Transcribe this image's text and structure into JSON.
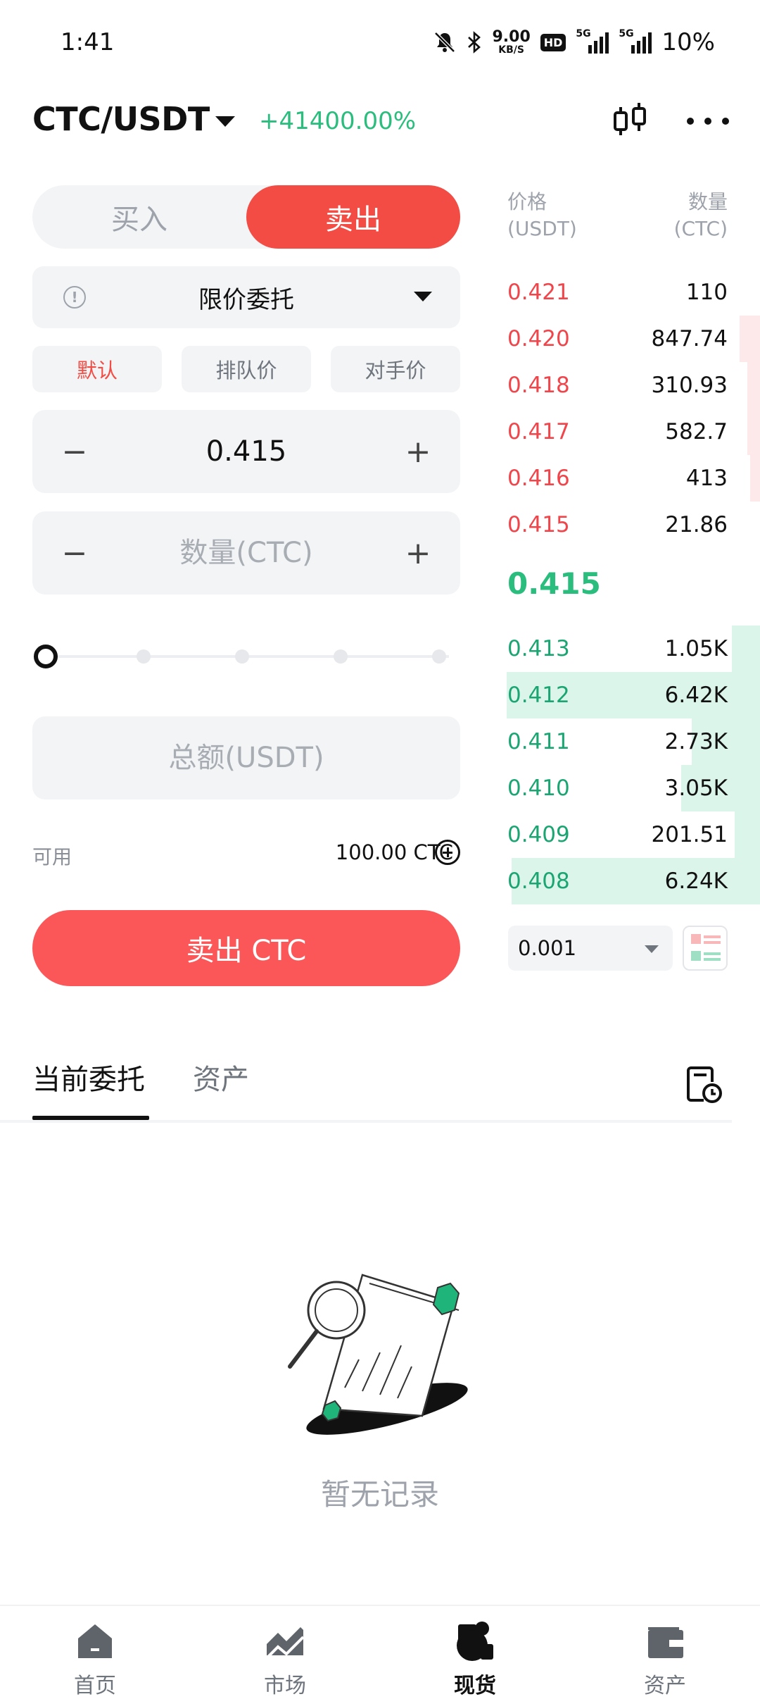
{
  "status_bar": {
    "time": "1:41",
    "net_speed_value": "9.00",
    "net_speed_unit": "KB/S",
    "hd_label": "HD",
    "sim1_label": "5G",
    "sim2_label": "5G",
    "battery": "10%"
  },
  "header": {
    "pair": "CTC/USDT",
    "change": "+41400.00%"
  },
  "trade_form": {
    "buy_label": "买入",
    "sell_label": "卖出",
    "order_type": "限价委托",
    "price_modes": [
      "默认",
      "排队价",
      "对手价"
    ],
    "price_value": "0.415",
    "quantity_placeholder": "数量(CTC)",
    "total_placeholder": "总额(USDT)",
    "minus_symbol": "−",
    "plus_symbol": "+",
    "slider_percent": 0,
    "available_label": "可用",
    "available_value": "100.00 CTC",
    "submit_label": "卖出 CTC"
  },
  "order_book": {
    "price_header": "价格",
    "price_unit": "(USDT)",
    "amount_header": "数量",
    "amount_unit": "(CTC)",
    "asks": [
      {
        "price": "0.421",
        "amount": "110",
        "depth": 0.0
      },
      {
        "price": "0.420",
        "amount": "847.74",
        "depth": 0.08
      },
      {
        "price": "0.418",
        "amount": "310.93",
        "depth": 0.05
      },
      {
        "price": "0.417",
        "amount": "582.7",
        "depth": 0.05
      },
      {
        "price": "0.416",
        "amount": "413",
        "depth": 0.04
      },
      {
        "price": "0.415",
        "amount": "21.86",
        "depth": 0.0
      }
    ],
    "last_price": "0.415",
    "bids": [
      {
        "price": "0.413",
        "amount": "1.05K",
        "depth": 0.11
      },
      {
        "price": "0.412",
        "amount": "6.42K",
        "depth": 1.0
      },
      {
        "price": "0.411",
        "amount": "2.73K",
        "depth": 0.27
      },
      {
        "price": "0.410",
        "amount": "3.05K",
        "depth": 0.31
      },
      {
        "price": "0.409",
        "amount": "201.51",
        "depth": 0.1
      },
      {
        "price": "0.408",
        "amount": "6.24K",
        "depth": 0.98
      }
    ],
    "precision": "0.001"
  },
  "tabs": {
    "current_orders": "当前委托",
    "assets": "资产"
  },
  "empty_state": {
    "text": "暂无记录"
  },
  "bottom_nav": {
    "items": [
      {
        "label": "首页"
      },
      {
        "label": "市场"
      },
      {
        "label": "现货"
      },
      {
        "label": "资产"
      }
    ]
  },
  "colors": {
    "sell_red": "#f24c45",
    "buy_green": "#2bbd7e",
    "ask_depth": "#fde9ea",
    "bid_depth": "#dcf5ea"
  }
}
